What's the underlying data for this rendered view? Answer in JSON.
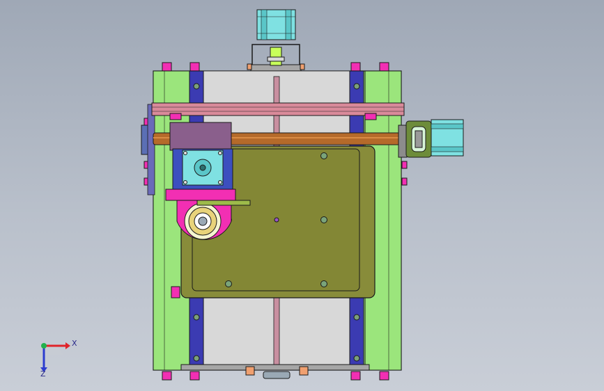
{
  "viewport": {
    "name": "cad-graphics-area"
  },
  "triad": {
    "x_label": "X",
    "z_label": "Z",
    "x_color": "#e0232a",
    "y_color": "#22b14c",
    "z_color": "#2c3ccf"
  },
  "colors": {
    "frame_green": "#9be57c",
    "rail_blue": "#3b3bb2",
    "pink_bar": "#d98a9a",
    "bronze_shaft": "#b56a2a",
    "plate_olive": "#888c3a",
    "magenta": "#f22fb3",
    "motor_teal": "#7fe1e2",
    "block_purple": "#8a5f8c"
  }
}
